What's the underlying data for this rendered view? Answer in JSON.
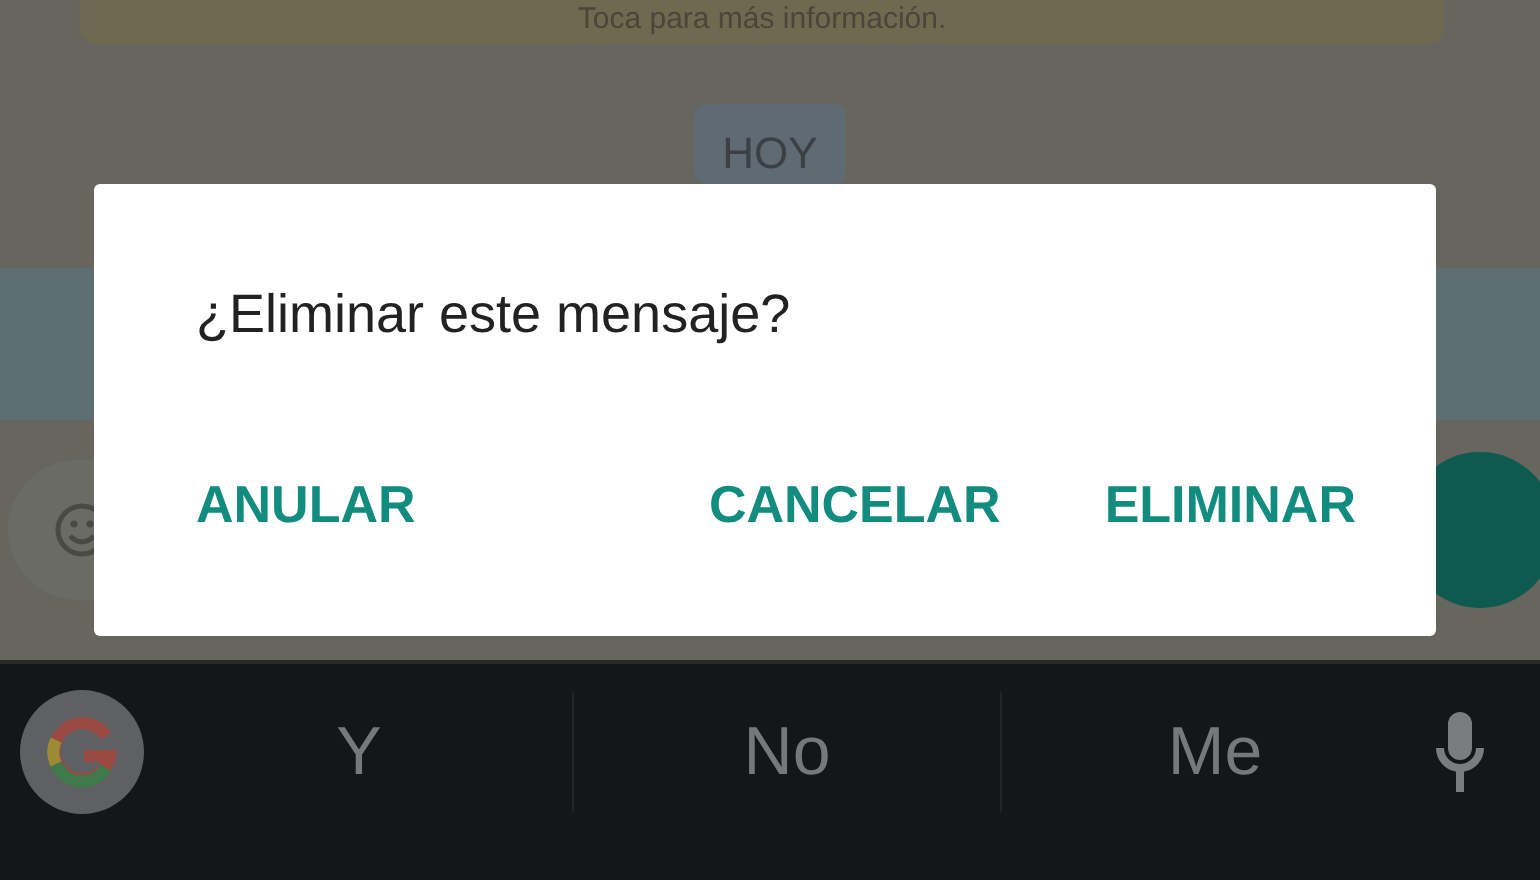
{
  "banner": {
    "text": "Toca para más información."
  },
  "date_chip": "HOY",
  "dialog": {
    "title": "¿Eliminar este mensaje?",
    "buttons": [
      {
        "label": "ANULAR"
      },
      {
        "label": "CANCELAR"
      },
      {
        "label": "ELIMINAR"
      }
    ]
  },
  "keyboard": {
    "suggestions": [
      "Y",
      "No",
      "Me"
    ]
  }
}
